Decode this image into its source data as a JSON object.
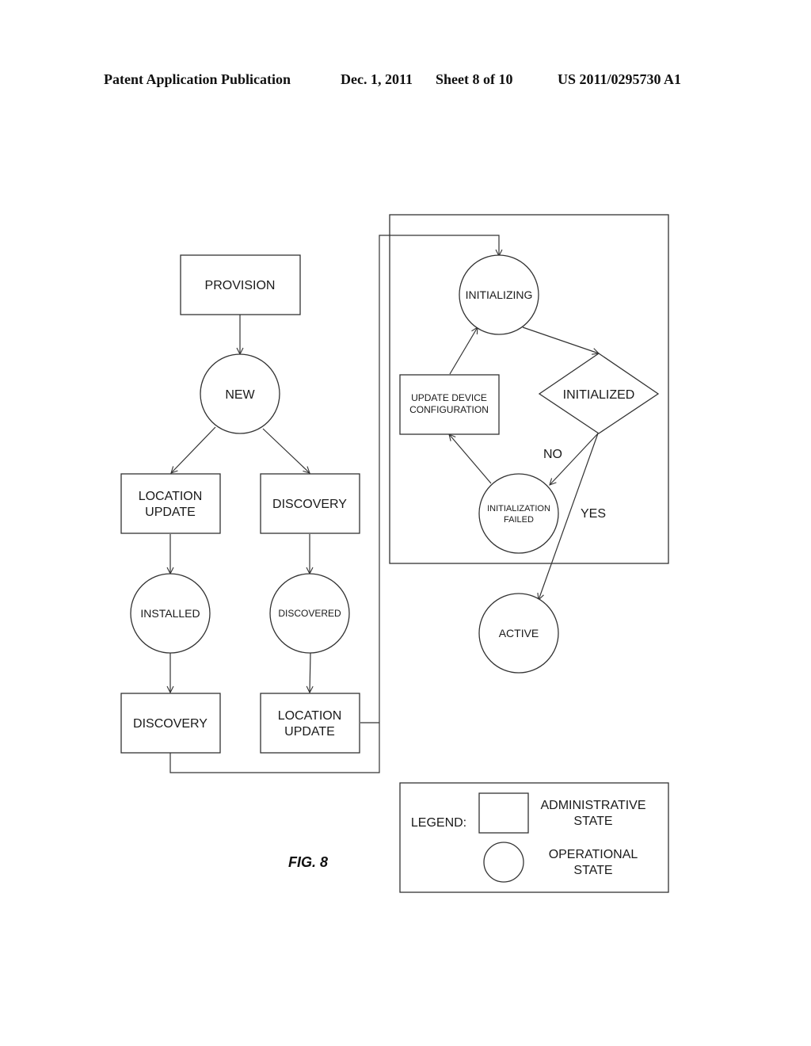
{
  "header": {
    "publication": "Patent Application Publication",
    "date": "Dec. 1, 2011",
    "sheet": "Sheet 8 of 10",
    "number": "US 2011/0295730 A1"
  },
  "figure_label": "FIG. 8",
  "nodes": {
    "provision": "PROVISION",
    "new": "NEW",
    "location_update_1_l1": "LOCATION",
    "location_update_1_l2": "UPDATE",
    "discovery_1": "DISCOVERY",
    "installed": "INSTALLED",
    "discovered": "DISCOVERED",
    "discovery_2": "DISCOVERY",
    "location_update_2_l1": "LOCATION",
    "location_update_2_l2": "UPDATE",
    "initializing": "INITIALIZING",
    "initialized": "INITIALIZED",
    "update_device_l1": "UPDATE DEVICE",
    "update_device_l2": "CONFIGURATION",
    "init_failed_l1": "INITIALIZATION",
    "init_failed_l2": "FAILED",
    "active": "ACTIVE"
  },
  "edge_labels": {
    "no": "NO",
    "yes": "YES"
  },
  "legend": {
    "title": "LEGEND:",
    "admin_l1": "ADMINISTRATIVE",
    "admin_l2": "STATE",
    "oper_l1": "OPERATIONAL",
    "oper_l2": "STATE"
  }
}
